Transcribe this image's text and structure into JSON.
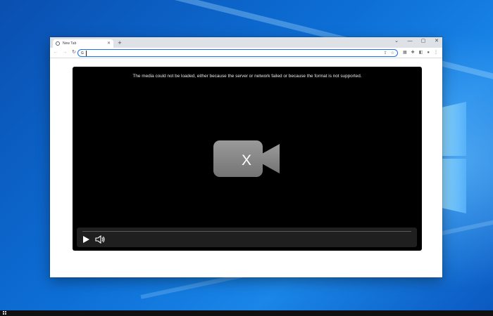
{
  "browser": {
    "tab": {
      "title": "New Tab",
      "close_glyph": "✕"
    },
    "new_tab_glyph": "+",
    "window_controls": {
      "dropdown": "⌄",
      "minimize": "—",
      "maximize": "▢",
      "close": "✕"
    },
    "nav": {
      "back": "←",
      "forward": "→",
      "reload": "↻"
    },
    "omnibox": {
      "value": "",
      "placeholder": "",
      "search_glyph": "G"
    },
    "omnibox_icons": {
      "share": "⇪",
      "bookmark": "☆"
    },
    "toolbar_icons": {
      "extension_1": "▦",
      "extensions": "✚",
      "side_panel": "◧",
      "profile": "●",
      "menu": "⋮"
    }
  },
  "player": {
    "error_message": "The media could not be loaded, either because the server or network failed or because the format is not supported.",
    "broken_icon_mark": "X",
    "controls": {
      "playing": false,
      "muted": false,
      "progress": 0
    }
  },
  "colors": {
    "accent": "#1a73e8",
    "player_bg": "#000000",
    "controls_bg": "#1f1f1f",
    "icon_gray": "#8a8a8a"
  },
  "icons": [
    "chrome-favicon-icon",
    "close-icon",
    "plus-icon",
    "back-icon",
    "forward-icon",
    "reload-icon",
    "share-icon",
    "star-icon",
    "extension-icon",
    "puzzle-icon",
    "side-panel-icon",
    "profile-icon",
    "menu-icon",
    "video-camera-broken-icon",
    "play-icon",
    "volume-icon",
    "windows-start-icon"
  ]
}
